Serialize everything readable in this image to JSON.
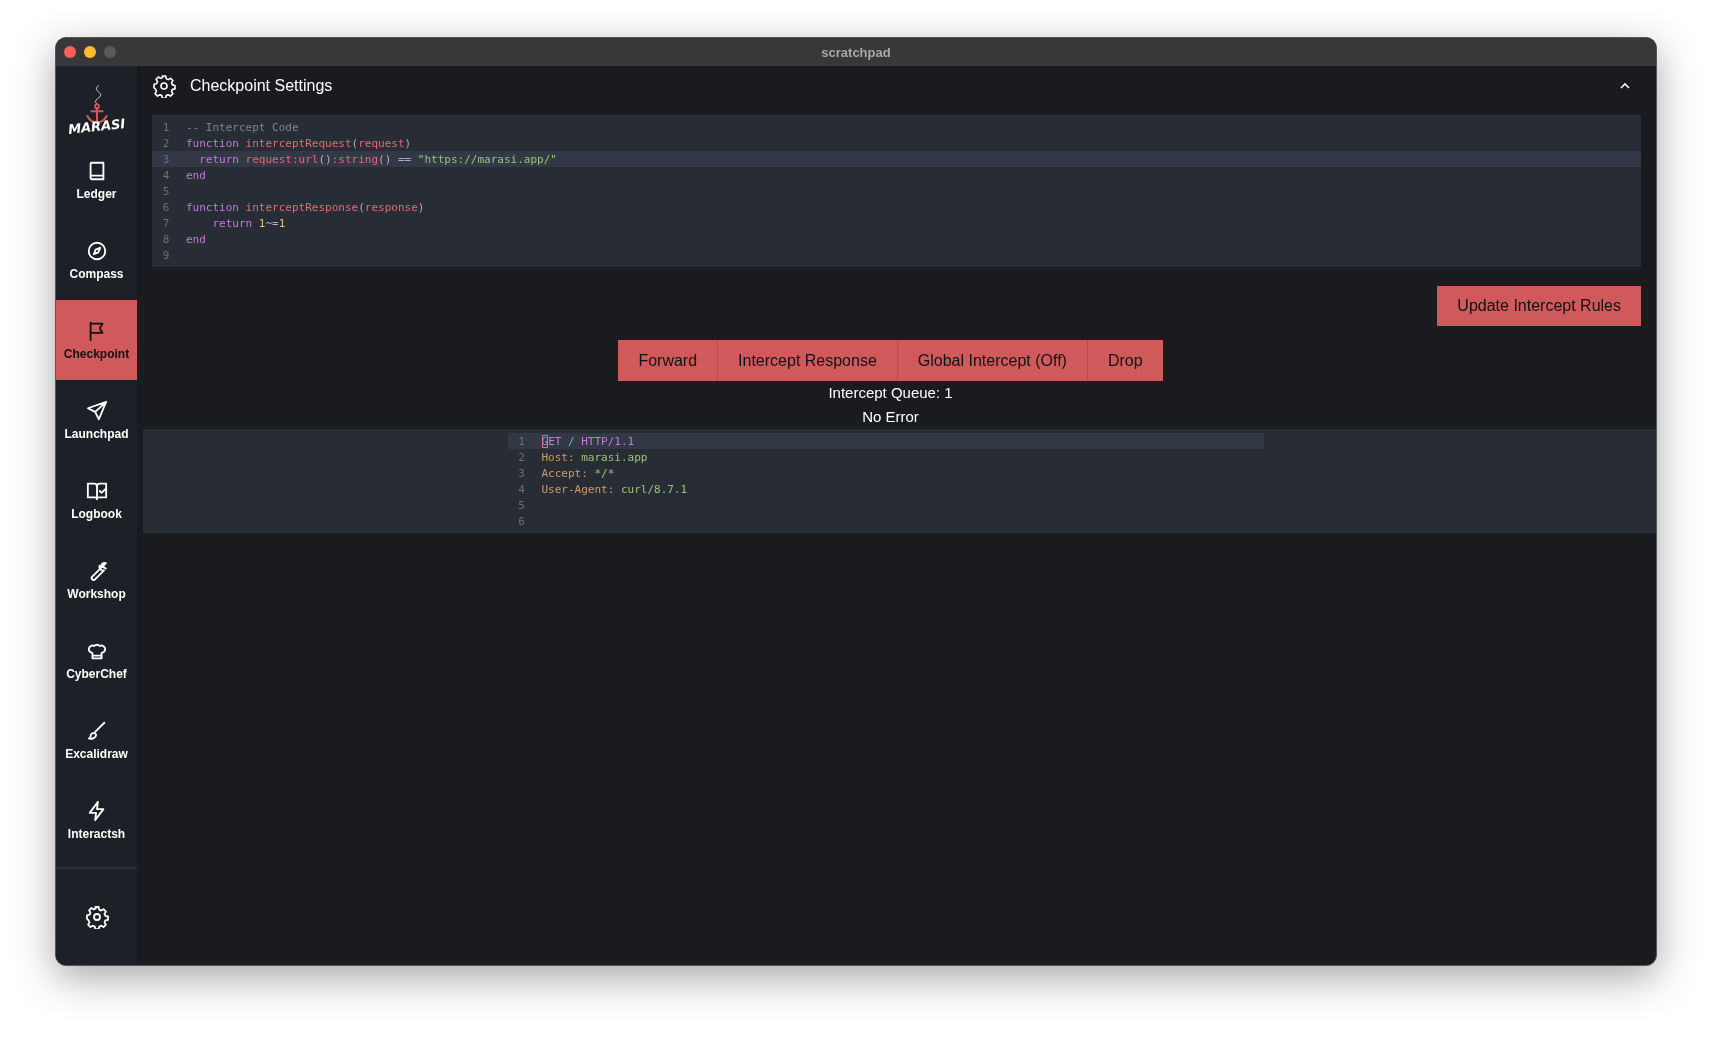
{
  "window": {
    "title": "scratchpad"
  },
  "sidebar": {
    "logo_text": "MARASI",
    "items": [
      {
        "label": "Ledger",
        "selected": false
      },
      {
        "label": "Compass",
        "selected": false
      },
      {
        "label": "Checkpoint",
        "selected": true
      },
      {
        "label": "Launchpad",
        "selected": false
      },
      {
        "label": "Logbook",
        "selected": false
      },
      {
        "label": "Workshop",
        "selected": false
      },
      {
        "label": "CyberChef",
        "selected": false
      },
      {
        "label": "Excalidraw",
        "selected": false
      },
      {
        "label": "Interactsh",
        "selected": false
      }
    ]
  },
  "settings_panel": {
    "title": "Checkpoint Settings",
    "expanded": true
  },
  "intercept_code": {
    "lines": [
      {
        "number": "1",
        "active": false,
        "tokens": [
          {
            "kind": "comment",
            "text": "-- Intercept Code"
          }
        ]
      },
      {
        "number": "2",
        "active": false,
        "tokens": [
          {
            "kind": "keyword",
            "text": "function "
          },
          {
            "kind": "name",
            "text": "interceptRequest"
          },
          {
            "kind": "punct",
            "text": "("
          },
          {
            "kind": "name",
            "text": "request"
          },
          {
            "kind": "punct",
            "text": ")"
          }
        ]
      },
      {
        "number": "3",
        "active": true,
        "tokens": [
          {
            "kind": "keyword",
            "text": "  return "
          },
          {
            "kind": "name",
            "text": "request:url"
          },
          {
            "kind": "punct",
            "text": "()"
          },
          {
            "kind": "name",
            "text": ":string"
          },
          {
            "kind": "punct",
            "text": "() == "
          },
          {
            "kind": "string",
            "text": "\"https://marasi.app/\""
          }
        ]
      },
      {
        "number": "4",
        "active": false,
        "tokens": [
          {
            "kind": "keyword",
            "text": "end"
          }
        ]
      },
      {
        "number": "5",
        "active": false
      },
      {
        "number": "6",
        "active": false,
        "tokens": [
          {
            "kind": "keyword",
            "text": "function "
          },
          {
            "kind": "name",
            "text": "interceptResponse"
          },
          {
            "kind": "punct",
            "text": "("
          },
          {
            "kind": "name",
            "text": "response"
          },
          {
            "kind": "punct",
            "text": ")"
          }
        ]
      },
      {
        "number": "7",
        "active": false,
        "tokens": [
          {
            "kind": "keyword",
            "text": "    return "
          },
          {
            "kind": "number",
            "text": "1"
          },
          {
            "kind": "punct",
            "text": "~="
          },
          {
            "kind": "number",
            "text": "1"
          }
        ]
      },
      {
        "number": "8",
        "active": false,
        "tokens": [
          {
            "kind": "keyword",
            "text": "end"
          }
        ]
      },
      {
        "number": "9",
        "active": false
      }
    ]
  },
  "update_button": {
    "label": "Update Intercept Rules"
  },
  "actions": [
    "Forward",
    "Intercept Response",
    "Global Intercept (Off)",
    "Drop"
  ],
  "queue_status": "Intercept Queue: 1",
  "error_status": "No Error",
  "request_editor": {
    "lines": [
      {
        "number": "1",
        "active": true,
        "tokens": [
          {
            "kind": "keyword",
            "text": "G",
            "cursor": true
          },
          {
            "kind": "keyword",
            "text": "ET "
          },
          {
            "kind": "operator",
            "text": "/ "
          },
          {
            "kind": "keyword",
            "text": "HTTP/1.1"
          }
        ]
      },
      {
        "number": "2",
        "active": false,
        "tokens": [
          {
            "kind": "header",
            "text": "Host: "
          },
          {
            "kind": "string",
            "text": "marasi.app"
          }
        ]
      },
      {
        "number": "3",
        "active": false,
        "tokens": [
          {
            "kind": "header",
            "text": "Accept: "
          },
          {
            "kind": "string",
            "text": "*/*"
          }
        ]
      },
      {
        "number": "4",
        "active": false,
        "tokens": [
          {
            "kind": "header",
            "text": "User-Agent: "
          },
          {
            "kind": "string",
            "text": "curl/8.7.1"
          }
        ]
      },
      {
        "number": "5",
        "active": false
      },
      {
        "number": "6",
        "active": false
      }
    ]
  }
}
